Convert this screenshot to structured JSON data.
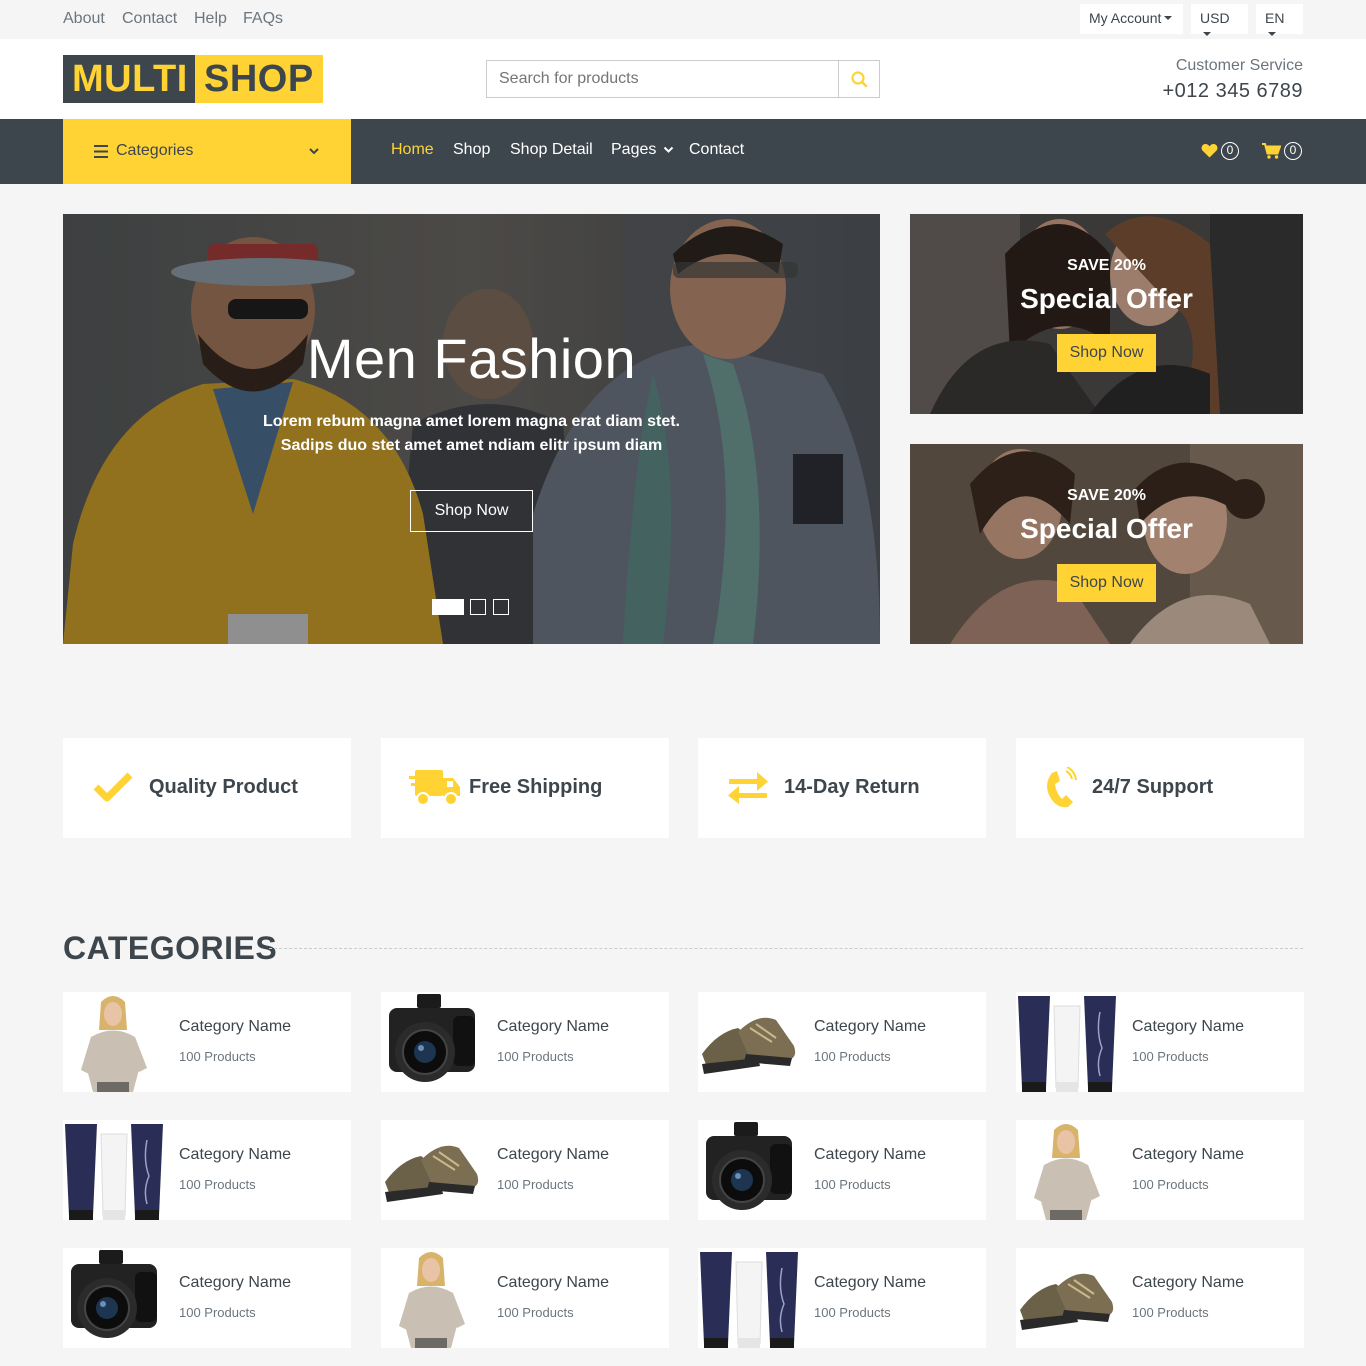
{
  "topbar": {
    "links": [
      "About",
      "Contact",
      "Help",
      "FAQs"
    ],
    "account": "My Account",
    "currency": "USD",
    "language": "EN"
  },
  "header": {
    "logo_part1": "MULTI",
    "logo_part2": "SHOP",
    "search_placeholder": "Search for products",
    "service_label": "Customer Service",
    "service_phone": "+012 345 6789"
  },
  "navbar": {
    "categories_label": "Categories",
    "links": [
      "Home",
      "Shop",
      "Shop Detail",
      "Pages",
      "Contact"
    ],
    "active": "Home",
    "wishlist_count": "0",
    "cart_count": "0"
  },
  "hero": {
    "title": "Men Fashion",
    "text": "Lorem rebum magna amet lorem magna erat diam stet. Sadips duo stet amet amet ndiam elitr ipsum diam",
    "button": "Shop Now",
    "active_slide": 1,
    "slide_count": 3
  },
  "offers": [
    {
      "save": "SAVE 20%",
      "title": "Special Offer",
      "button": "Shop Now"
    },
    {
      "save": "SAVE 20%",
      "title": "Special Offer",
      "button": "Shop Now"
    }
  ],
  "features": [
    {
      "icon": "check-icon",
      "label": "Quality Product"
    },
    {
      "icon": "truck-icon",
      "label": "Free Shipping"
    },
    {
      "icon": "exchange-icon",
      "label": "14-Day Return"
    },
    {
      "icon": "phone-icon",
      "label": "24/7 Support"
    }
  ],
  "categories_title": "CATEGORIES",
  "categories": [
    {
      "name": "Category Name",
      "count": "100 Products",
      "image": "woman-sweater-image"
    },
    {
      "name": "Category Name",
      "count": "100 Products",
      "image": "camera-image"
    },
    {
      "name": "Category Name",
      "count": "100 Products",
      "image": "shoes-image"
    },
    {
      "name": "Category Name",
      "count": "100 Products",
      "image": "cosmetics-image"
    },
    {
      "name": "Category Name",
      "count": "100 Products",
      "image": "cosmetics-image"
    },
    {
      "name": "Category Name",
      "count": "100 Products",
      "image": "shoes-image"
    },
    {
      "name": "Category Name",
      "count": "100 Products",
      "image": "camera-image"
    },
    {
      "name": "Category Name",
      "count": "100 Products",
      "image": "woman-sweater-image"
    },
    {
      "name": "Category Name",
      "count": "100 Products",
      "image": "camera-image"
    },
    {
      "name": "Category Name",
      "count": "100 Products",
      "image": "woman-sweater-image"
    },
    {
      "name": "Category Name",
      "count": "100 Products",
      "image": "cosmetics-image"
    },
    {
      "name": "Category Name",
      "count": "100 Products",
      "image": "shoes-image"
    }
  ],
  "colors": {
    "primary": "#FFD333",
    "dark": "#3D464D",
    "light": "#F5F5F5"
  }
}
